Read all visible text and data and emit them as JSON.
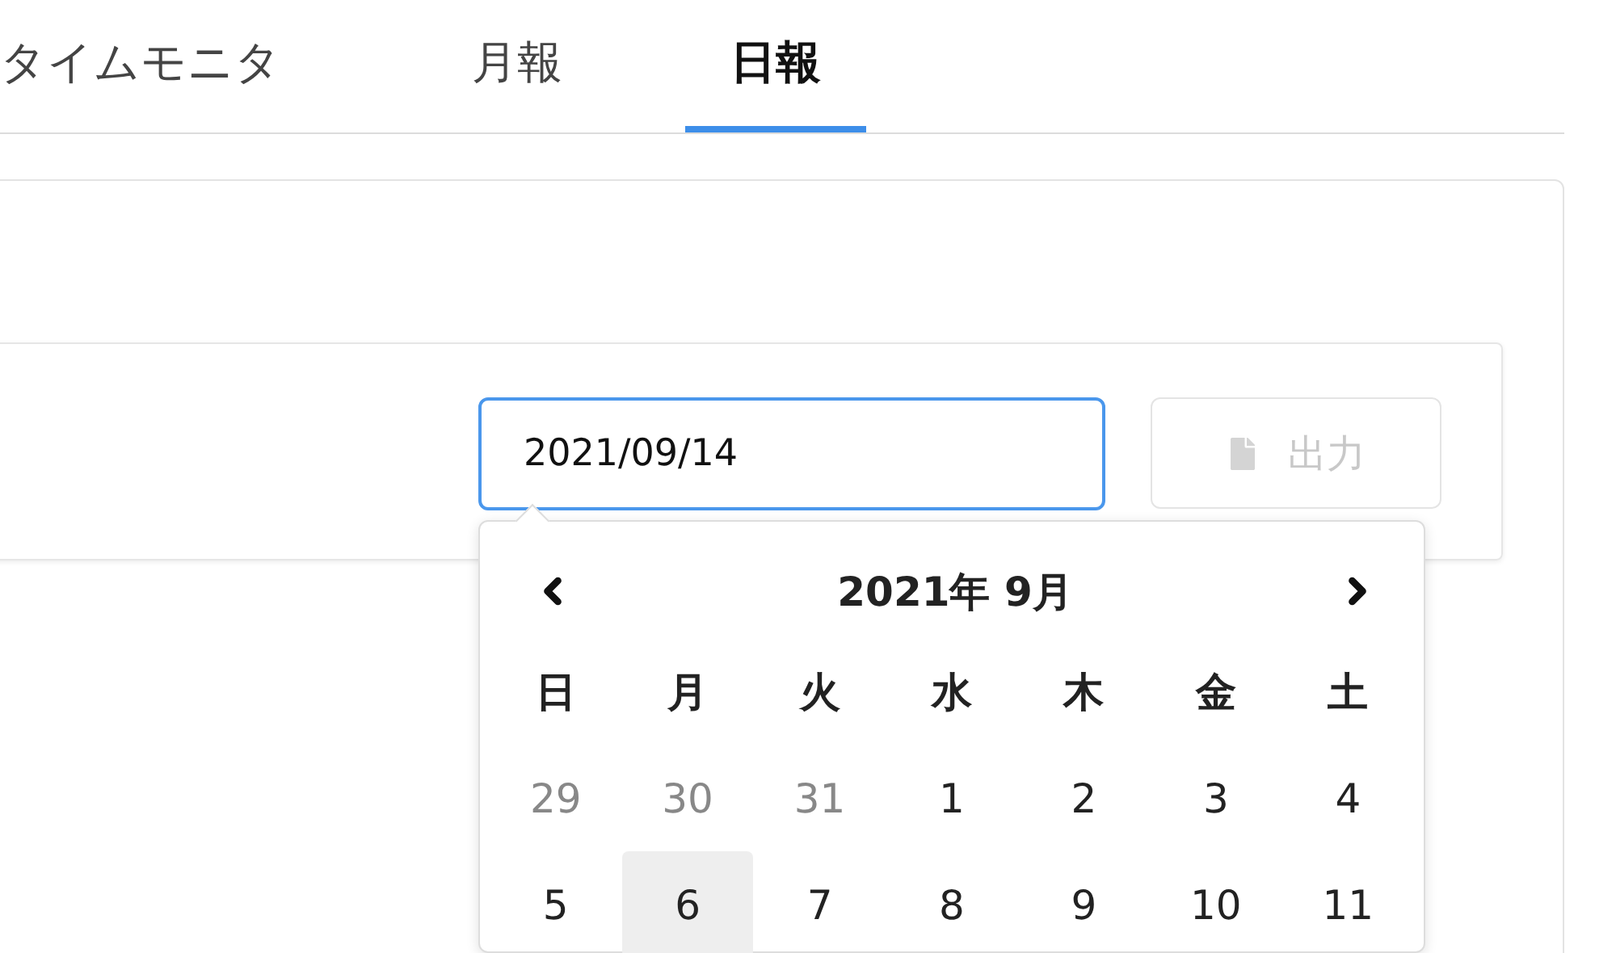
{
  "tabs": [
    {
      "label": "タイムモニタ",
      "selected": false
    },
    {
      "label": "月報",
      "selected": false
    },
    {
      "label": "日報",
      "selected": true
    }
  ],
  "date_field": {
    "value": "2021/09/14",
    "focused": true
  },
  "output_button": {
    "label": "出力",
    "disabled": true
  },
  "calendar": {
    "title": "2021年 9月",
    "weekdays": [
      "日",
      "月",
      "火",
      "水",
      "木",
      "金",
      "土"
    ],
    "weeks": [
      [
        {
          "label": "29",
          "outside": true,
          "highlighted": false
        },
        {
          "label": "30",
          "outside": true,
          "highlighted": false
        },
        {
          "label": "31",
          "outside": true,
          "highlighted": false
        },
        {
          "label": "1",
          "outside": false,
          "highlighted": false
        },
        {
          "label": "2",
          "outside": false,
          "highlighted": false
        },
        {
          "label": "3",
          "outside": false,
          "highlighted": false
        },
        {
          "label": "4",
          "outside": false,
          "highlighted": false
        }
      ],
      [
        {
          "label": "5",
          "outside": false,
          "highlighted": false
        },
        {
          "label": "6",
          "outside": false,
          "highlighted": true
        },
        {
          "label": "7",
          "outside": false,
          "highlighted": false
        },
        {
          "label": "8",
          "outside": false,
          "highlighted": false
        },
        {
          "label": "9",
          "outside": false,
          "highlighted": false
        },
        {
          "label": "10",
          "outside": false,
          "highlighted": false
        },
        {
          "label": "11",
          "outside": false,
          "highlighted": false
        }
      ]
    ]
  }
}
